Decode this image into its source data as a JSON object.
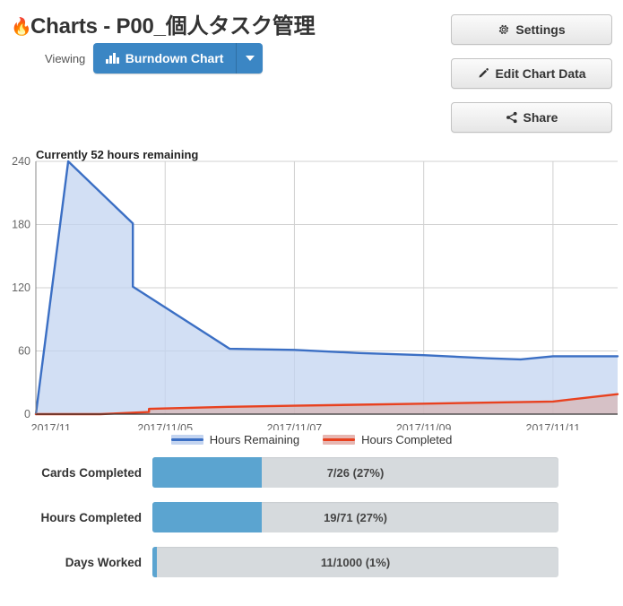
{
  "header": {
    "fire_icon": "🔥",
    "title": "Charts - P00_個人タスク管理",
    "viewing_label": "Viewing",
    "chart_type_label": "Burndown Chart",
    "chart_type_icon": "bar-chart-icon",
    "caret_icon": "chevron-down-icon",
    "buttons": [
      {
        "label": "Settings",
        "icon": "gear-icon"
      },
      {
        "label": "Edit Chart Data",
        "icon": "pencil-icon"
      },
      {
        "label": "Share",
        "icon": "share-icon"
      }
    ]
  },
  "chart_note": "Currently 52 hours remaining",
  "chart_data": {
    "type": "area",
    "title": "Currently 52 hours remaining",
    "xlabel": "",
    "ylabel": "",
    "ylim": [
      0,
      240
    ],
    "yticks": [
      0,
      60,
      120,
      180,
      240
    ],
    "xticks": [
      "2017/11...",
      "2017/11/05",
      "2017/11/07",
      "2017/11/09",
      "2017/11/11"
    ],
    "xlim": [
      "2017/11/03",
      "2017/11/12"
    ],
    "grid": true,
    "legend_position": "bottom",
    "colors": {
      "hours_remaining_line": "#3b6fc4",
      "hours_remaining_fill": "#c3d4f0",
      "hours_completed_line": "#e8411f",
      "hours_completed_fill": "#d9b0ae"
    },
    "series": [
      {
        "name": "Hours Remaining",
        "points": [
          {
            "x": "2017/11/03",
            "y": 0
          },
          {
            "x": "2017/11/03 12:00",
            "y": 240
          },
          {
            "x": "2017/11/04 12:00",
            "y": 181
          },
          {
            "x": "2017/11/04 12:00",
            "y": 121
          },
          {
            "x": "2017/11/06",
            "y": 62
          },
          {
            "x": "2017/11/07",
            "y": 61
          },
          {
            "x": "2017/11/08",
            "y": 58
          },
          {
            "x": "2017/11/09",
            "y": 56
          },
          {
            "x": "2017/11/10",
            "y": 53
          },
          {
            "x": "2017/11/10 12:00",
            "y": 52
          },
          {
            "x": "2017/11/11",
            "y": 55
          },
          {
            "x": "2017/11/12",
            "y": 55
          }
        ]
      },
      {
        "name": "Hours Completed",
        "points": [
          {
            "x": "2017/11/03",
            "y": 0
          },
          {
            "x": "2017/11/04",
            "y": 0
          },
          {
            "x": "2017/11/04 18:00",
            "y": 2
          },
          {
            "x": "2017/11/04 18:00",
            "y": 5
          },
          {
            "x": "2017/11/06",
            "y": 7
          },
          {
            "x": "2017/11/07",
            "y": 8
          },
          {
            "x": "2017/11/09",
            "y": 10
          },
          {
            "x": "2017/11/11",
            "y": 12
          },
          {
            "x": "2017/11/12",
            "y": 19
          }
        ]
      }
    ]
  },
  "legend": [
    {
      "label": "Hours Remaining",
      "line_color": "#3b6fc4",
      "fill_color": "#c3d4f0"
    },
    {
      "label": "Hours Completed",
      "line_color": "#e8411f",
      "fill_color": "#e7b6b1"
    }
  ],
  "stats": [
    {
      "label": "Cards Completed",
      "text": "7/26 (27%)",
      "percent": 27
    },
    {
      "label": "Hours Completed",
      "text": "19/71 (27%)",
      "percent": 27
    },
    {
      "label": "Days Worked",
      "text": "11/1000 (1%)",
      "percent": 1
    }
  ]
}
